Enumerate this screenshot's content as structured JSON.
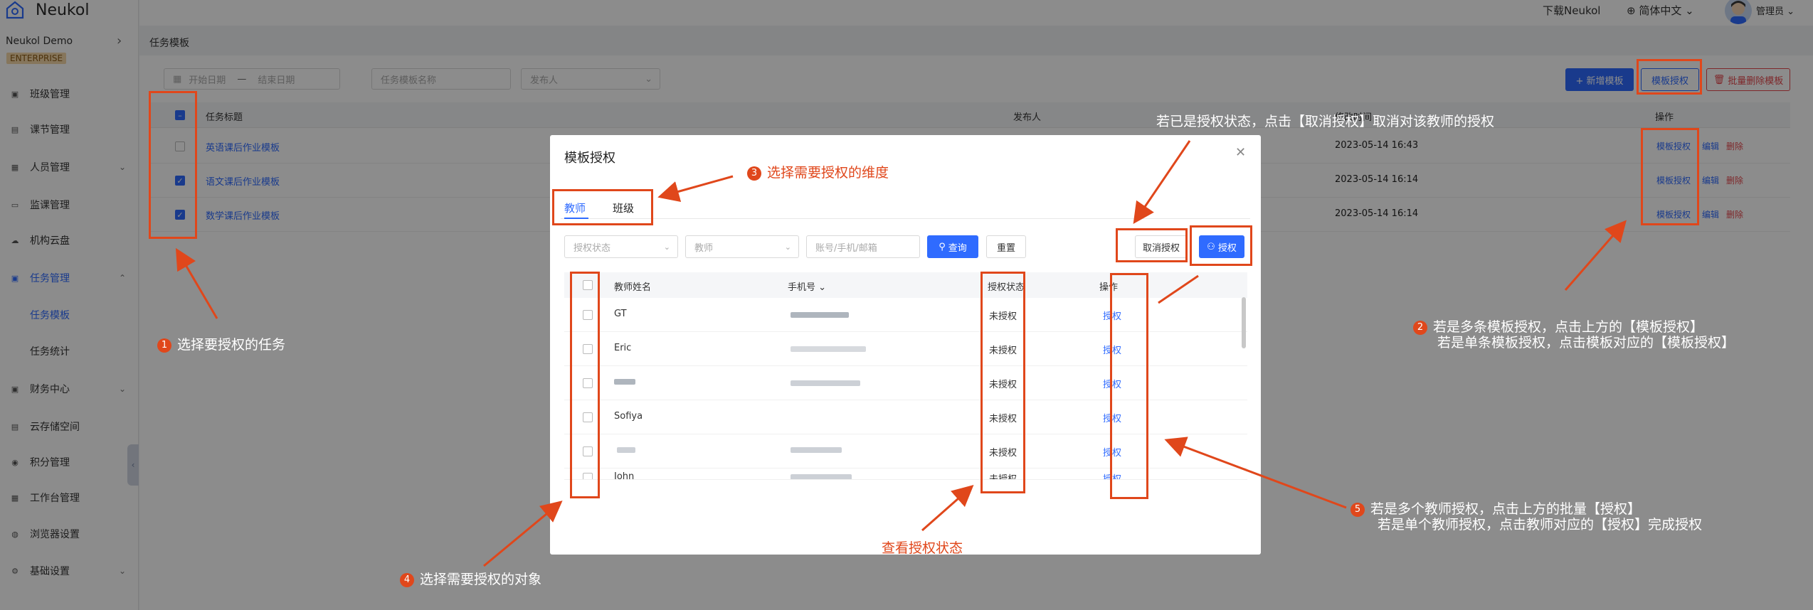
{
  "app": {
    "brand": "Neukol",
    "org": "Neukol Demo",
    "edition": "ENTERPRISE"
  },
  "header": {
    "download": "下载Neukol",
    "language": "简体中文",
    "user": "管理员"
  },
  "sidebar": {
    "items": [
      {
        "label": "班级管理",
        "icon": "class-icon"
      },
      {
        "label": "课节管理",
        "icon": "lesson-icon"
      },
      {
        "label": "人员管理",
        "icon": "people-icon"
      },
      {
        "label": "监课管理",
        "icon": "monitor-icon"
      },
      {
        "label": "机构云盘",
        "icon": "cloud-icon"
      },
      {
        "label": "任务管理",
        "icon": "task-icon"
      },
      {
        "label": "财务中心",
        "icon": "finance-icon"
      },
      {
        "label": "云存储空间",
        "icon": "storage-icon"
      },
      {
        "label": "积分管理",
        "icon": "points-icon"
      },
      {
        "label": "工作台管理",
        "icon": "workbench-icon"
      },
      {
        "label": "浏览器设置",
        "icon": "browser-icon"
      },
      {
        "label": "基础设置",
        "icon": "settings-icon"
      }
    ],
    "sub": [
      "任务模板",
      "任务统计"
    ]
  },
  "breadcrumb": "任务模板",
  "filters": {
    "start": "开始日期",
    "sep": "—",
    "end": "结束日期",
    "name": "任务模板名称",
    "publisher": "发布人"
  },
  "toolbar": {
    "add": "+ 新增模板",
    "authorize": "模板授权",
    "batch_delete": "批量删除模板"
  },
  "table": {
    "headers": {
      "title": "任务标题",
      "publisher": "发布人",
      "time": "修改时间",
      "op": "操作"
    },
    "rows": [
      {
        "title": "英语课后作业模板",
        "time": "2023-05-14 16:43",
        "checked": false
      },
      {
        "title": "语文课后作业模板",
        "time": "2023-05-14 16:14",
        "checked": true
      },
      {
        "title": "数学课后作业模板",
        "time": "2023-05-14 16:14",
        "checked": true
      }
    ],
    "row_ops": {
      "auth": "模板授权",
      "edit": "编辑",
      "del": "删除"
    }
  },
  "modal": {
    "title": "模板授权",
    "tabs": [
      "教师",
      "班级"
    ],
    "filters": {
      "status": "授权状态",
      "teacher": "教师",
      "account": "账号/手机/邮箱"
    },
    "query": "查询",
    "reset": "重置",
    "revoke": "取消授权",
    "grant": "授权",
    "headers": {
      "name": "教师姓名",
      "phone": "手机号",
      "status": "授权状态",
      "op": "操作"
    },
    "rows": [
      {
        "name": "GT",
        "status": "未授权",
        "op": "授权"
      },
      {
        "name": "Eric",
        "status": "未授权",
        "op": "授权"
      },
      {
        "name": "",
        "status": "未授权",
        "op": "授权"
      },
      {
        "name": "Sofiya",
        "status": "未授权",
        "op": "授权"
      },
      {
        "name": "",
        "status": "未授权",
        "op": "授权"
      },
      {
        "name": "John",
        "status": "未授权",
        "op": "授权"
      }
    ]
  },
  "annotations": {
    "a1": "选择要授权的任务",
    "a2_line1": "若是多条模板授权，点击上方的【模板授权】",
    "a2_line2": "若是单条模板授权，点击模板对应的【模板授权】",
    "a3": "选择需要授权的维度",
    "a4": "选择需要授权的对象",
    "a5_line1": "若是多个教师授权，点击上方的批量【授权】",
    "a5_line2": "若是单个教师授权，点击教师对应的【授权】完成授权",
    "revoke_note": "若已是授权状态，点击【取消授权】取消对该教师的授权",
    "status_note": "查看授权状态",
    "n1": "1",
    "n2": "2",
    "n3": "3",
    "n4": "4",
    "n5": "5"
  },
  "colors": {
    "accent": "#2f6bff",
    "annotation": "#e0471b",
    "danger": "#e5484d"
  }
}
